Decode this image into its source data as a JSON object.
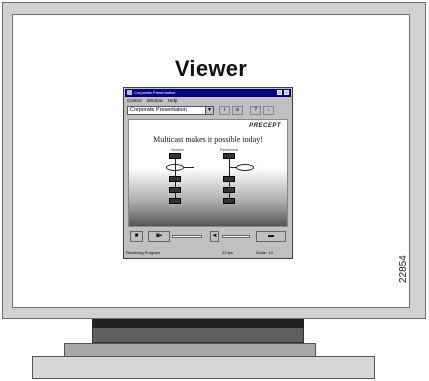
{
  "monitor": {
    "title": "Viewer"
  },
  "figure_number": "22854",
  "app": {
    "window_title": "Corporate Presentation",
    "menu": [
      "Control",
      "Window",
      "Help"
    ],
    "channel": "Corporate Presentation",
    "toolbar_buttons": [
      "i",
      "⊙",
      "?",
      "↓"
    ],
    "brand": "PRECEPT",
    "headline": "Multicast makes it possible today!",
    "column_labels": [
      "Sender",
      "Receivers"
    ],
    "status": {
      "left": "Receiving Program",
      "mid": "22 fps",
      "right": "Scale: 1X"
    },
    "icons": {
      "stop": "stop-icon",
      "speaker": "speaker-icon"
    }
  }
}
